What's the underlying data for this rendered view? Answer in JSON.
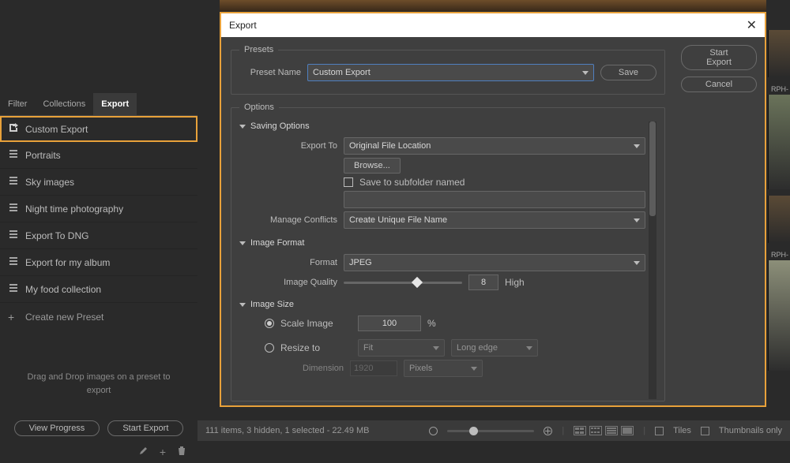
{
  "left": {
    "tabs": [
      "Filter",
      "Collections",
      "Export"
    ],
    "active_tab": 2,
    "presets": [
      {
        "label": "Custom Export",
        "highlight": true,
        "icon": "export"
      },
      {
        "label": "Portraits"
      },
      {
        "label": "Sky images"
      },
      {
        "label": "Night time photography"
      },
      {
        "label": "Export To DNG"
      },
      {
        "label": "Export for my album"
      },
      {
        "label": "My food collection"
      }
    ],
    "create_label": "Create new Preset",
    "hint": "Drag and Drop images on a preset to export",
    "view_progress": "View Progress",
    "start_export": "Start Export"
  },
  "modal": {
    "title": "Export",
    "presets_legend": "Presets",
    "preset_name_label": "Preset Name",
    "preset_name_value": "Custom Export",
    "save_label": "Save",
    "options_legend": "Options",
    "saving_options_label": "Saving Options",
    "export_to_label": "Export To",
    "export_to_value": "Original File Location",
    "browse_label": "Browse...",
    "subfolder_label": "Save to subfolder named",
    "subfolder_value": "",
    "manage_conflicts_label": "Manage Conflicts",
    "manage_conflicts_value": "Create Unique File Name",
    "image_format_label": "Image Format",
    "format_label": "Format",
    "format_value": "JPEG",
    "quality_label": "Image Quality",
    "quality_value": "8",
    "quality_text": "High",
    "image_size_label": "Image Size",
    "scale_label": "Scale Image",
    "scale_value": "100",
    "scale_unit": "%",
    "resize_label": "Resize to",
    "fit_value": "Fit",
    "edge_value": "Long edge",
    "dimension_label": "Dimension",
    "dimension_value": "1920",
    "dimension_unit": "Pixels",
    "start_export": "Start Export",
    "cancel": "Cancel"
  },
  "bottom": {
    "status": "111 items, 3 hidden, 1 selected - 22.49 MB",
    "tiles": "Tiles",
    "thumbs_only": "Thumbnails only"
  },
  "thumbs": {
    "label1": "RPH-",
    "label2": "RPH-"
  }
}
